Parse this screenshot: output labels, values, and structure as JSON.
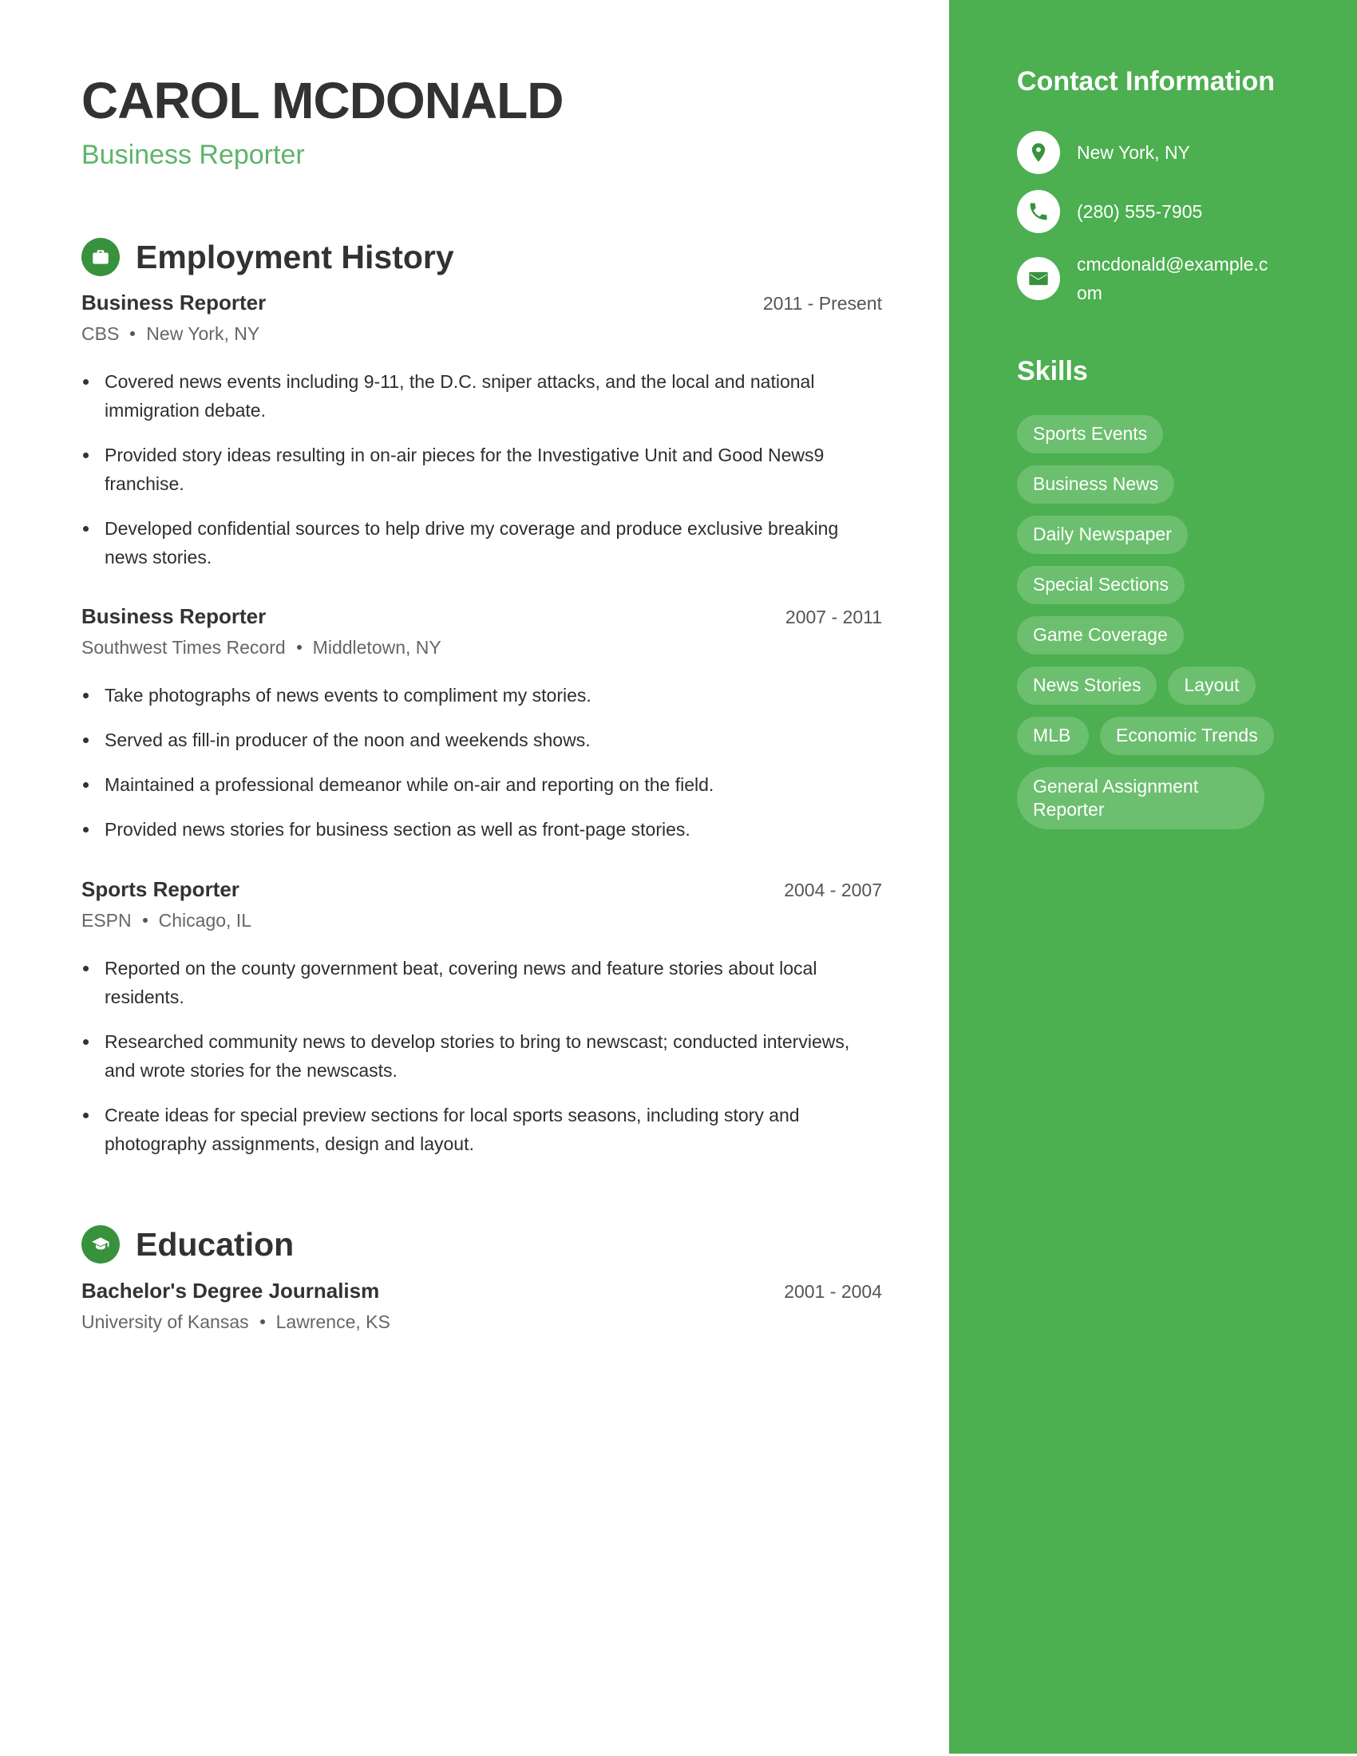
{
  "header": {
    "name": "CAROL MCDONALD",
    "title": "Business Reporter"
  },
  "colors": {
    "accent": "#4caf50",
    "icon_bg": "#38923d",
    "subtitle": "#5fb46a",
    "pill_bg": "#6cbf6f"
  },
  "employment": {
    "heading": "Employment History",
    "icon": "briefcase-icon",
    "jobs": [
      {
        "role": "Business Reporter",
        "dates": "2011 - Present",
        "employer": "CBS",
        "location": "New York, NY",
        "bullets": [
          "Covered news events including 9-11, the D.C. sniper attacks, and the local and national immigration debate.",
          "Provided story ideas resulting in on-air pieces for the Investigative Unit and Good News9 franchise.",
          "Developed confidential sources to help drive my coverage and produce exclusive breaking news stories."
        ]
      },
      {
        "role": "Business Reporter",
        "dates": "2007 - 2011",
        "employer": "Southwest Times Record",
        "location": "Middletown, NY",
        "bullets": [
          "Take photographs of news events to compliment my stories.",
          "Served as fill-in producer of the noon and weekends shows.",
          "Maintained a professional demeanor while on-air and reporting on the field.",
          "Provided news stories for business section as well as front-page stories."
        ]
      },
      {
        "role": "Sports Reporter",
        "dates": "2004 - 2007",
        "employer": "ESPN",
        "location": "Chicago, IL",
        "bullets": [
          "Reported on the county government beat, covering news and feature stories about local residents.",
          "Researched community news to develop stories to bring to newscast; conducted interviews, and wrote stories for the newscasts.",
          "Create ideas for special preview sections for local sports seasons, including story and photography assignments, design and layout."
        ]
      }
    ]
  },
  "education": {
    "heading": "Education",
    "icon": "graduation-cap-icon",
    "items": [
      {
        "degree": "Bachelor's Degree Journalism",
        "dates": "2001 - 2004",
        "school": "University of Kansas",
        "location": "Lawrence, KS"
      }
    ]
  },
  "contact": {
    "heading": "Contact Information",
    "items": [
      {
        "icon": "map-pin-icon",
        "value": "New York, NY"
      },
      {
        "icon": "phone-icon",
        "value": "(280) 555-7905"
      },
      {
        "icon": "envelope-icon",
        "value": "cmcdonald@example.com"
      }
    ]
  },
  "skills": {
    "heading": "Skills",
    "items": [
      "Sports Events",
      "Business News",
      "Daily Newspaper",
      "Special Sections",
      "Game Coverage",
      "News Stories",
      "Layout",
      "MLB",
      "Economic Trends",
      "General Assignment Reporter"
    ]
  }
}
